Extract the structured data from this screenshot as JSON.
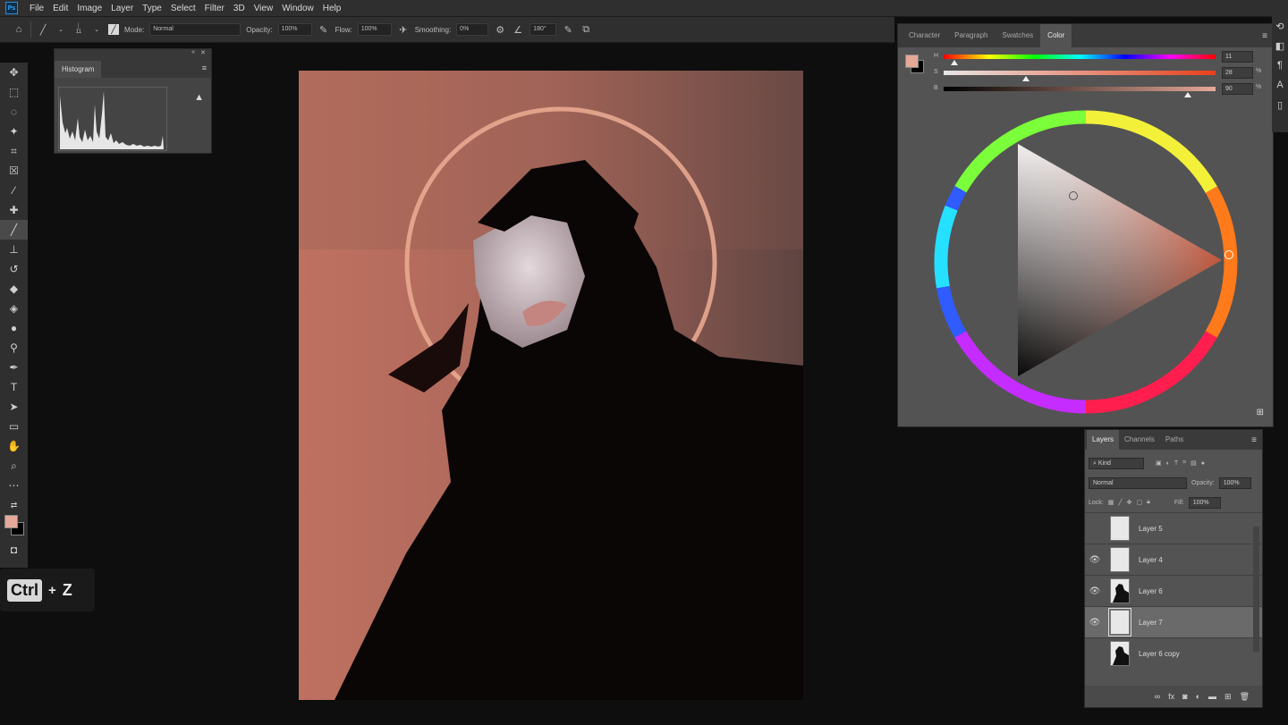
{
  "menubar": {
    "logo": "Ps",
    "items": [
      "File",
      "Edit",
      "Image",
      "Layer",
      "Type",
      "Select",
      "Filter",
      "3D",
      "View",
      "Window",
      "Help"
    ]
  },
  "options": {
    "brush_size": "11",
    "mode_label": "Mode:",
    "mode_value": "Normal",
    "opacity_label": "Opacity:",
    "opacity_value": "100%",
    "flow_label": "Flow:",
    "flow_value": "100%",
    "smoothing_label": "Smoothing:",
    "smoothing_value": "0%",
    "angle_value": "180°"
  },
  "histogram": {
    "tab": "Histogram"
  },
  "color_panel": {
    "tabs": [
      "Character",
      "Paragraph",
      "Swatches",
      "Color"
    ],
    "active_tab": "Color",
    "foreground": "#e6a898",
    "background": "#000000",
    "sliders": [
      {
        "label": "H",
        "value": "11",
        "unit": ""
      },
      {
        "label": "S",
        "value": "28",
        "unit": "%"
      },
      {
        "label": "B",
        "value": "90",
        "unit": "%"
      }
    ]
  },
  "layers_panel": {
    "tabs": [
      "Layers",
      "Channels",
      "Paths"
    ],
    "active_tab": "Layers",
    "filter_kind": "Kind",
    "blend_mode": "Normal",
    "opacity_label": "Opacity:",
    "opacity_value": "100%",
    "lock_label": "Lock:",
    "fill_label": "Fill:",
    "fill_value": "100%",
    "layers": [
      {
        "name": "Layer 5",
        "visible": false,
        "selected": false,
        "thumb": "white"
      },
      {
        "name": "Layer 4",
        "visible": true,
        "selected": false,
        "thumb": "white"
      },
      {
        "name": "Layer 6",
        "visible": true,
        "selected": false,
        "thumb": "figure"
      },
      {
        "name": "Layer 7",
        "visible": true,
        "selected": true,
        "thumb": "white"
      },
      {
        "name": "Layer 6 copy",
        "visible": false,
        "selected": false,
        "thumb": "figure"
      }
    ]
  },
  "overlay": {
    "key": "Ctrl",
    "plus": "+",
    "letter": "Z"
  }
}
